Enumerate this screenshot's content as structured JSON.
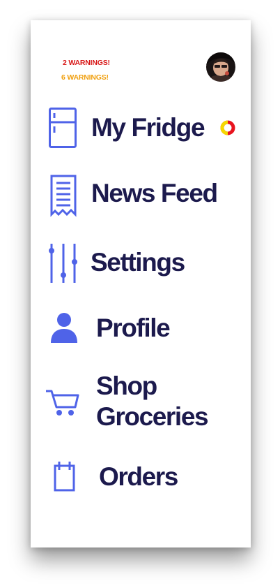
{
  "colors": {
    "accent": "#4f63e8",
    "label": "#1c1a4d",
    "warning_red": "#d81818",
    "warning_orange": "#f0a010",
    "status_yellow": "#f5d800",
    "status_red": "#e8141e"
  },
  "warnings": {
    "critical": "2 WARNINGS!",
    "minor": "6 WARNINGS!"
  },
  "nav": {
    "fridge": {
      "label": "My Fridge",
      "icon": "fridge-icon"
    },
    "news": {
      "label": "News Feed",
      "icon": "receipt-icon"
    },
    "settings": {
      "label": "Settings",
      "icon": "sliders-icon"
    },
    "profile": {
      "label": "Profile",
      "icon": "person-icon"
    },
    "shop": {
      "label": "Shop Groceries",
      "icon": "cart-icon"
    },
    "orders": {
      "label": "Orders",
      "icon": "clipboard-icon"
    }
  },
  "profile": {
    "avatar_icon": "user-avatar"
  }
}
